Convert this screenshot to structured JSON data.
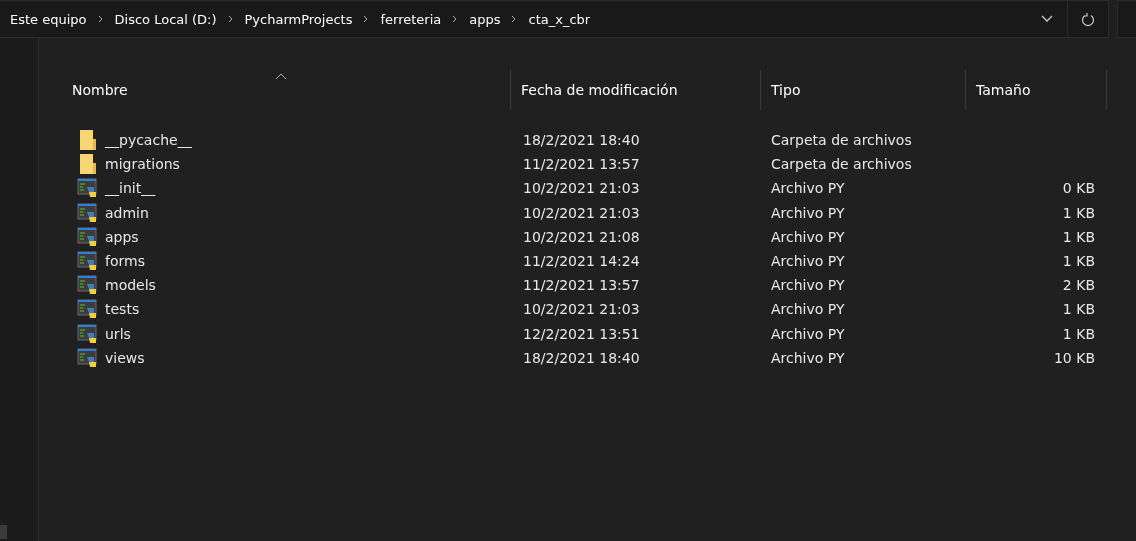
{
  "address_bar": {
    "path": [
      "Este equipo",
      "Disco Local (D:)",
      "PycharmProjects",
      "ferreteria",
      "apps",
      "cta_x_cbr"
    ]
  },
  "table": {
    "columns": [
      {
        "label": "Nombre",
        "sorted": true
      },
      {
        "label": "Fecha de modificación",
        "sorted": false
      },
      {
        "label": "Tipo",
        "sorted": false
      },
      {
        "label": "Tamaño",
        "sorted": false
      }
    ],
    "rows": [
      {
        "kind": "folder",
        "name": "__pycache__",
        "date": "18/2/2021 18:40",
        "type": "Carpeta de archivos"
      },
      {
        "kind": "folder",
        "name": "migrations",
        "date": "11/2/2021 13:57",
        "type": "Carpeta de archivos"
      },
      {
        "kind": "py",
        "name": "__init__",
        "date": "10/2/2021 21:03",
        "type": "Archivo PY",
        "size": "0 KB"
      },
      {
        "kind": "py",
        "name": "admin",
        "date": "10/2/2021 21:03",
        "type": "Archivo PY",
        "size": "1 KB"
      },
      {
        "kind": "py",
        "name": "apps",
        "date": "10/2/2021 21:08",
        "type": "Archivo PY",
        "size": "1 KB"
      },
      {
        "kind": "py",
        "name": "forms",
        "date": "11/2/2021 14:24",
        "type": "Archivo PY",
        "size": "1 KB"
      },
      {
        "kind": "py",
        "name": "models",
        "date": "11/2/2021 13:57",
        "type": "Archivo PY",
        "size": "2 KB"
      },
      {
        "kind": "py",
        "name": "tests",
        "date": "10/2/2021 21:03",
        "type": "Archivo PY",
        "size": "1 KB"
      },
      {
        "kind": "py",
        "name": "urls",
        "date": "12/2/2021 13:51",
        "type": "Archivo PY",
        "size": "1 KB"
      },
      {
        "kind": "py",
        "name": "views",
        "date": "18/2/2021 18:40",
        "type": "Archivo PY",
        "size": "10 KB"
      }
    ]
  }
}
